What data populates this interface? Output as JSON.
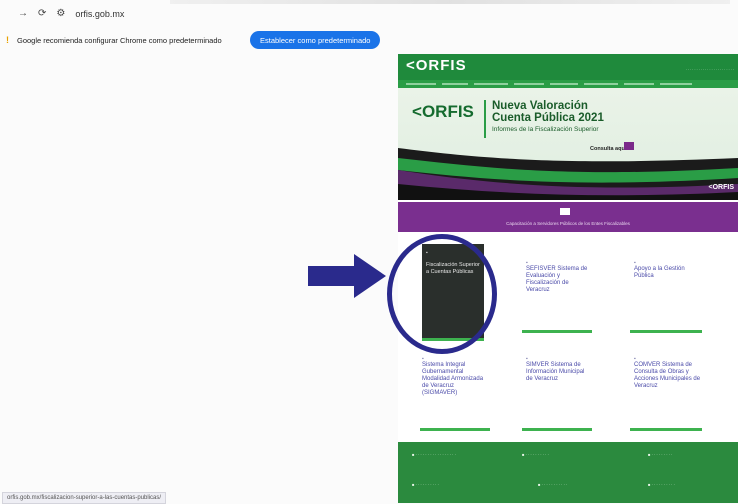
{
  "browser": {
    "address": "orfis.gob.mx",
    "icons": [
      "forward-icon",
      "reload-icon",
      "site-settings-icon"
    ]
  },
  "infobar": {
    "message": "Google recomienda configurar Chrome como predeterminado",
    "button": "Establecer como predeterminado"
  },
  "site": {
    "logo": "ORFIS",
    "banner": {
      "logo": "ORFIS",
      "title_line1": "Nueva Valoración",
      "title_line2": "Cuenta Pública 2021",
      "subtitle": "Informes de la Fiscalización Superior",
      "cta": "Consulta aquí",
      "corner_logo": "ORFIS"
    },
    "purple_band": "Capacitación a Servidores Públicos de los Entes Fiscalizables",
    "cards": [
      {
        "title": "Fiscalización Superior a Cuentas Públicas"
      },
      {
        "title": "SEFISVER Sistema de Evaluación y Fiscalización de Veracruz"
      },
      {
        "title": "Apoyo a la Gestión Pública"
      },
      {
        "title": "Sistema Integral Gubernamental Modalidad Armonizada de Veracruz (SIGMAVER)"
      },
      {
        "title": "SIMVER Sistema de Información Municipal de Veracruz"
      },
      {
        "title": "COMVER Sistema de Consulta de Obras y Acciones Municipales de Veracruz"
      }
    ]
  },
  "status_url": "orfis.gob.mx/fiscalizacion-superior-a-las-cuentas-publicas/",
  "colors": {
    "accent_green": "#1f8a3c",
    "purple": "#7a2f8f",
    "annotation_blue": "#2a2a8c",
    "chrome_blue": "#1a73e8"
  }
}
